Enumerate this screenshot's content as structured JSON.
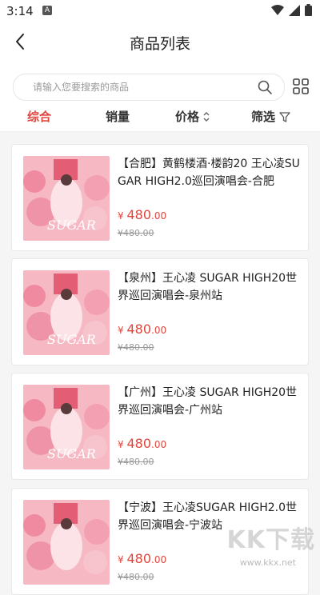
{
  "status": {
    "time": "3:14",
    "app_badge": "A"
  },
  "header": {
    "title": "商品列表"
  },
  "search": {
    "placeholder": "请输入您要搜索的商品"
  },
  "sort": {
    "tabs": [
      {
        "label": "综合",
        "active": true
      },
      {
        "label": "销量",
        "active": false
      },
      {
        "label": "价格",
        "active": false
      },
      {
        "label": "筛选",
        "active": false
      }
    ]
  },
  "products": [
    {
      "title": "【合肥】黄鹤楼酒·楼韵20 王心凌SUGAR HIGH2.0巡回演唱会-合肥",
      "price_symbol": "¥",
      "price_int": "480",
      "price_dec": ".00",
      "old_price": "¥480.00"
    },
    {
      "title": "【泉州】王心凌 SUGAR HIGH20世界巡回演唱会-泉州站",
      "price_symbol": "¥",
      "price_int": "480",
      "price_dec": ".00",
      "old_price": "¥480.00"
    },
    {
      "title": "【广州】王心凌 SUGAR HIGH20世界巡回演唱会-广州站",
      "price_symbol": "¥",
      "price_int": "480",
      "price_dec": ".00",
      "old_price": "¥480.00"
    },
    {
      "title": "【宁波】王心凌SUGAR HIGH2.0世界巡回演唱会-宁波站",
      "price_symbol": "¥",
      "price_int": "480",
      "price_dec": ".00",
      "old_price": "¥480.00"
    }
  ],
  "watermark": {
    "logo": "KK下载",
    "url": "www.kkx.net"
  },
  "colors": {
    "accent": "#e0463e",
    "poster_pink": "#f4a7b4"
  }
}
